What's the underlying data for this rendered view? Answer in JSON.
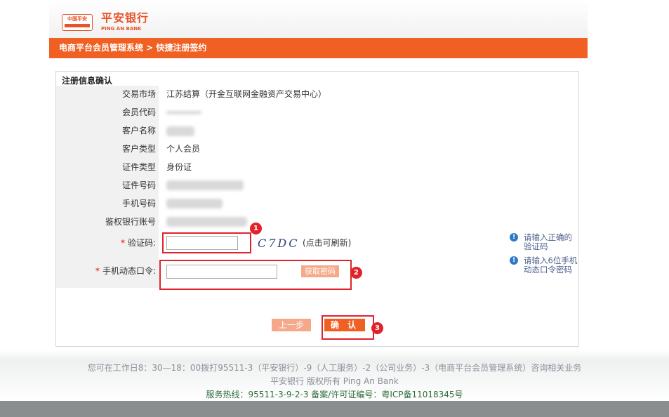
{
  "header": {
    "logo_top": "中国平安",
    "brand_cn": "平安银行",
    "brand_en": "PING AN BANK"
  },
  "nav": {
    "crumb": "电商平台会员管理系统 > 快捷注册签约"
  },
  "panel": {
    "title": "注册信息确认",
    "rows": [
      {
        "label": "交易市场",
        "value": "江苏结算（开金互联网金融资产交易中心）"
      },
      {
        "label": "会员代码",
        "value": ""
      },
      {
        "label": "客户名称",
        "value": ""
      },
      {
        "label": "客户类型",
        "value": "个人会员"
      },
      {
        "label": "证件类型",
        "value": "身份证"
      },
      {
        "label": "证件号码",
        "value": ""
      },
      {
        "label": "手机号码",
        "value": ""
      },
      {
        "label": "鉴权银行账号",
        "value": ""
      }
    ],
    "captcha": {
      "label": "验证码:",
      "required_mark": "*",
      "input_value": "",
      "image_text": "C7DC",
      "refresh_note": "(点击可刷新)"
    },
    "sms": {
      "label": "手机动态口令:",
      "required_mark": "*",
      "input_value": "",
      "button_label": "获取密码"
    },
    "hints": [
      "请输入正确的验证码",
      "请输入6位手机动态口令密码"
    ],
    "hint_icon_glyph": "!",
    "annotations": [
      "1",
      "2",
      "3"
    ],
    "buttons": {
      "prev": "上一步",
      "confirm": "确 认"
    }
  },
  "footer": {
    "line1": "您可在工作日8：30—18：00拨打95511-3（平安银行）-9（人工服务）-2（公司业务）-3（电商平台会员管理系统）咨询相关业务",
    "line2": "平安银行 版权所有 Ping An Bank",
    "line3": "服务热线：95511-3-9-2-3   备案/许可证编号：粤ICP备11018345号"
  },
  "colors": {
    "brand_orange": "#f06022",
    "light_orange": "#f5a98a",
    "annotation_red": "#e0232b",
    "hint_blue": "#2d79c8"
  }
}
